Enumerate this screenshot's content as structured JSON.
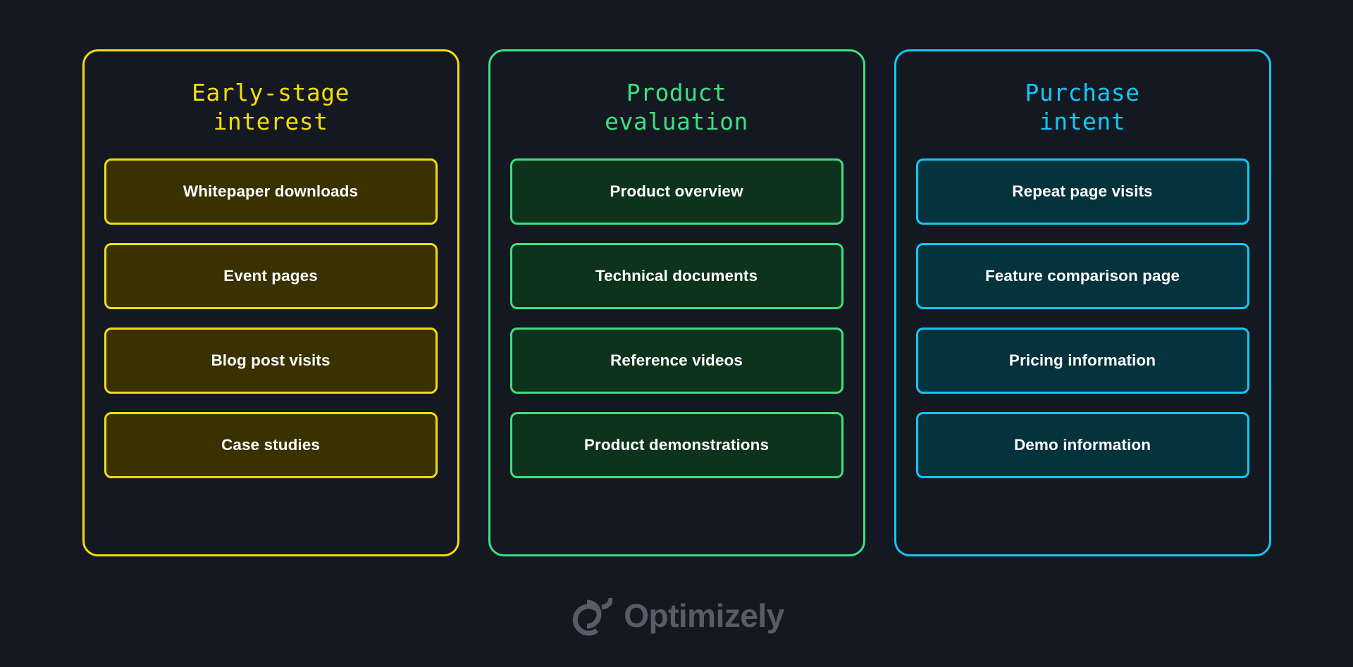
{
  "background_color": "#141821",
  "columns": [
    {
      "title": "Early-stage\ninterest",
      "accent_color": "#f5dd0a",
      "fill_color": "#3a3101",
      "items": [
        "Whitepaper downloads",
        "Event pages",
        "Blog post visits",
        "Case studies"
      ]
    },
    {
      "title": "Product\nevaluation",
      "accent_color": "#3ee07f",
      "fill_color": "#0d331d",
      "items": [
        "Product overview",
        "Technical documents",
        "Reference videos",
        "Product demonstrations"
      ]
    },
    {
      "title": "Purchase\nintent",
      "accent_color": "#14c8f5",
      "fill_color": "#04323d",
      "items": [
        "Repeat page visits",
        "Feature comparison page",
        "Pricing information",
        "Demo information"
      ]
    }
  ],
  "footer": {
    "logo_icon": "optimizely-logo-mark",
    "brand_name": "Optimizely",
    "logo_color": "#575d68"
  }
}
